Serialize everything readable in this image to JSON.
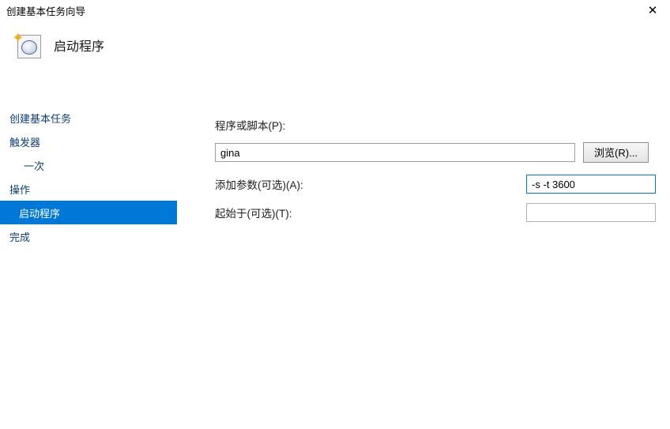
{
  "window": {
    "title": "创建基本任务向导",
    "close_glyph": "✕"
  },
  "header": {
    "page_title": "启动程序"
  },
  "sidebar": {
    "create_basic_task": "创建基本任务",
    "trigger": "触发器",
    "trigger_once": "一次",
    "action": "操作",
    "action_start_program": "启动程序",
    "finish": "完成"
  },
  "form": {
    "program_label": "程序或脚本(P):",
    "program_value": "gina",
    "browse_label": "浏览(R)...",
    "arguments_label": "添加参数(可选)(A):",
    "arguments_value": "-s -t 3600",
    "startin_label": "起始于(可选)(T):",
    "startin_value": ""
  }
}
